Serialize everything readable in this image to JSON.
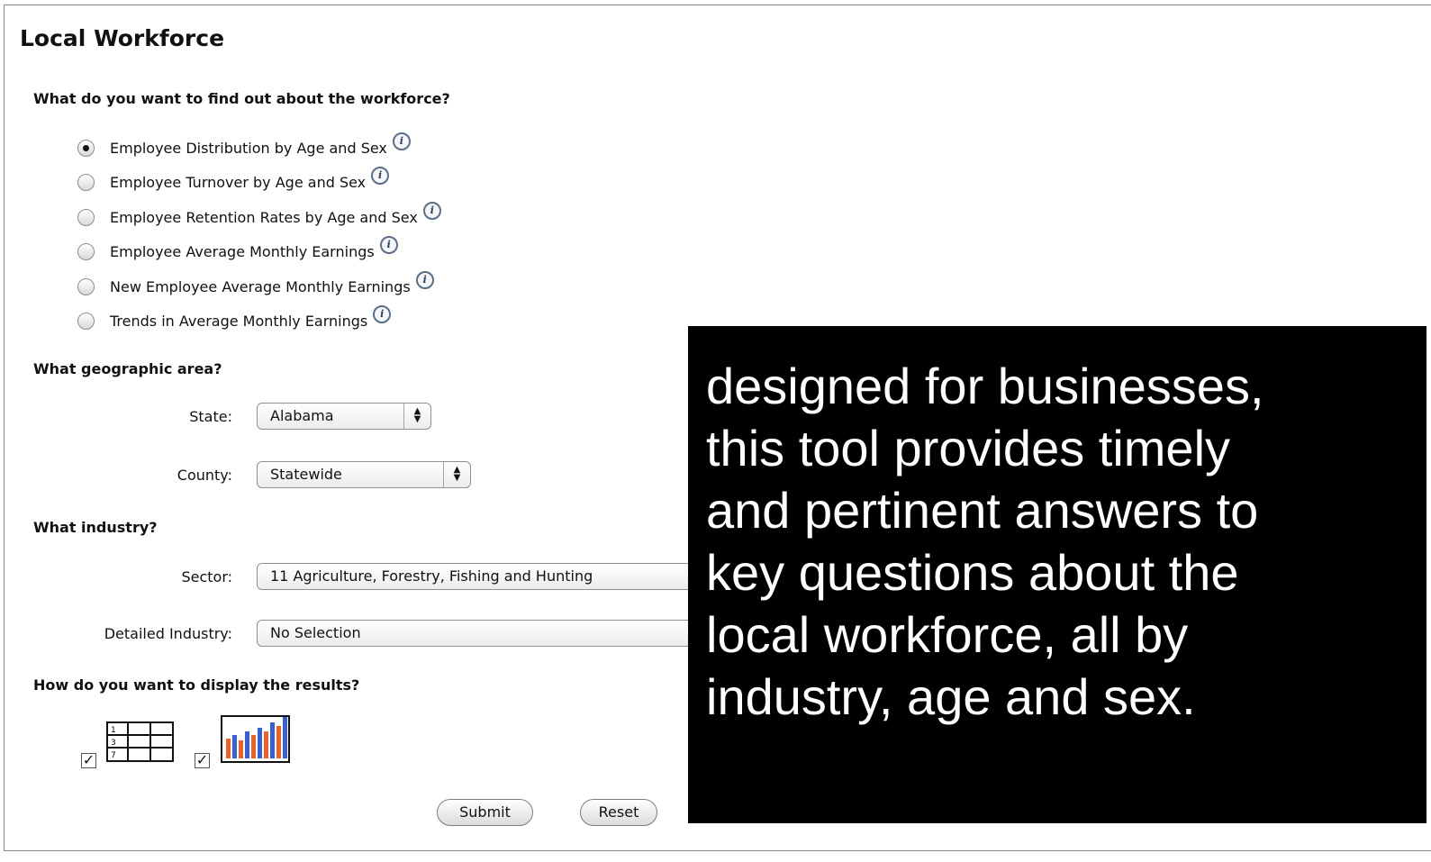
{
  "page": {
    "title": "Local Workforce"
  },
  "questions": {
    "workforce": {
      "heading": "What do you want to find out about the workforce?",
      "options": [
        {
          "label": "Employee Distribution by Age and Sex",
          "selected": true
        },
        {
          "label": "Employee Turnover by Age and Sex",
          "selected": false
        },
        {
          "label": "Employee Retention Rates by Age and Sex",
          "selected": false
        },
        {
          "label": "Employee Average Monthly Earnings",
          "selected": false
        },
        {
          "label": "New Employee Average Monthly Earnings",
          "selected": false
        },
        {
          "label": "Trends in Average Monthly Earnings",
          "selected": false
        }
      ],
      "info_icon": "info-icon",
      "info_glyph": "i"
    },
    "geography": {
      "heading": "What geographic area?",
      "state_label": "State:",
      "state_value": "Alabama",
      "county_label": "County:",
      "county_value": "Statewide"
    },
    "industry": {
      "heading": "What industry?",
      "sector_label": "Sector:",
      "sector_value": "11 Agriculture, Forestry, Fishing and Hunting",
      "detailed_label": "Detailed Industry:",
      "detailed_value": "No Selection"
    },
    "display": {
      "heading": "How do you want to display the results?",
      "table_checked": true,
      "chart_checked": true,
      "table_icon_numbers": [
        "1",
        "3",
        "7"
      ],
      "check_glyph": "✓",
      "chart_bar_colors": [
        "#e8632a",
        "#3a5fd0"
      ]
    }
  },
  "actions": {
    "submit_label": "Submit",
    "reset_label": "Reset"
  },
  "overlay": {
    "lines": [
      "designed for businesses,",
      "this tool provides timely",
      "and pertinent answers to",
      "key questions about the",
      "local workforce, all by",
      "industry, age and sex."
    ]
  },
  "select_arrows": {
    "up": "▲",
    "down": "▼"
  }
}
